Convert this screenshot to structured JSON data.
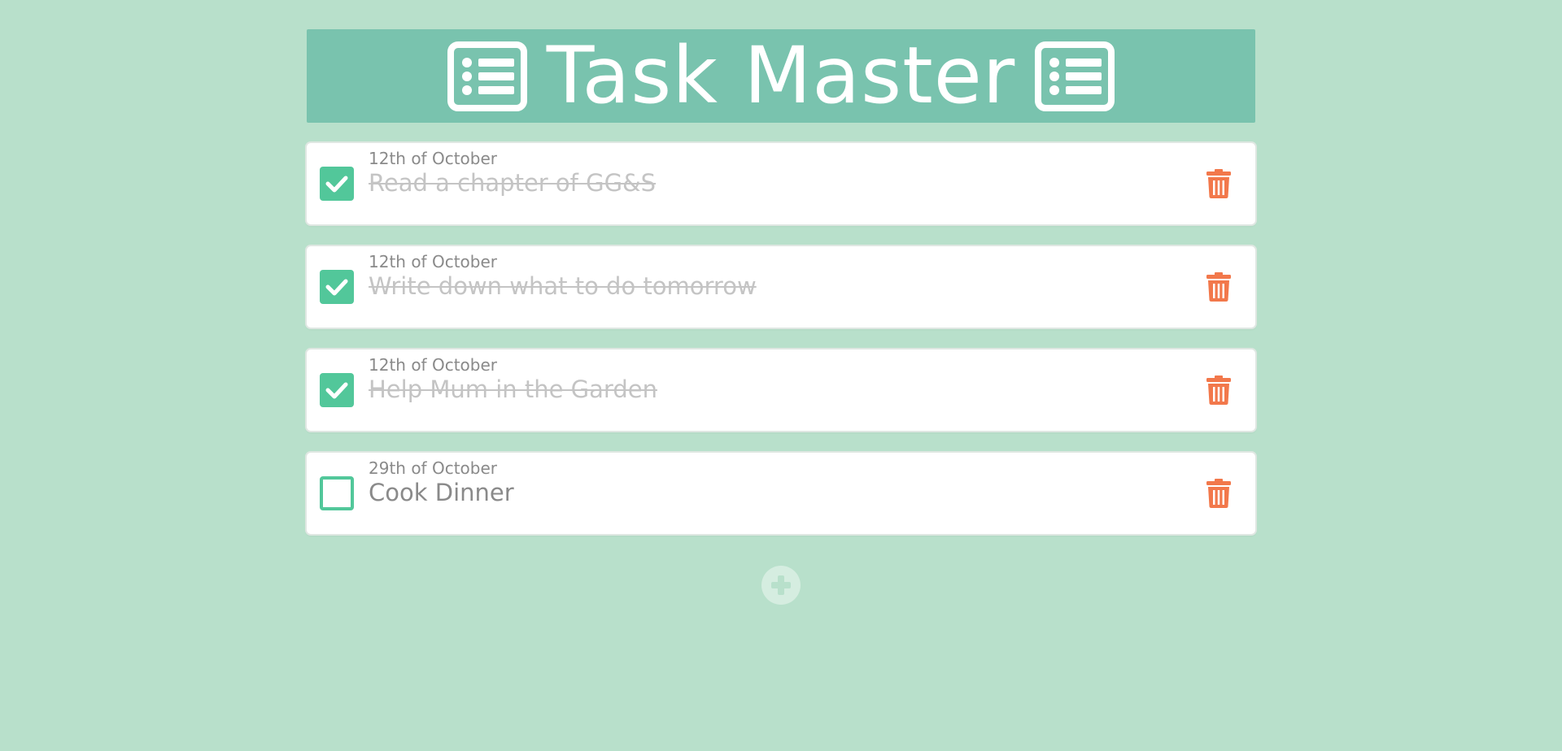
{
  "header": {
    "title": "Task Master",
    "left_icon": "list-alt-icon",
    "right_icon": "list-alt-icon"
  },
  "tasks": [
    {
      "date": "12th of October",
      "text": "Read a chapter of GG&S",
      "done": true
    },
    {
      "date": "12th of October",
      "text": "Write down what to do tomorrow",
      "done": true
    },
    {
      "date": "12th of October",
      "text": "Help Mum in the Garden",
      "done": true
    },
    {
      "date": "29th of October",
      "text": "Cook Dinner",
      "done": false
    }
  ],
  "icons": {
    "checkbox_checked": "check-icon",
    "delete": "trash-icon",
    "add": "plus-circle-icon"
  },
  "colors": {
    "background": "#b8e0cb",
    "header": "#79c3ae",
    "accent": "#52c79a",
    "delete": "#f2784b",
    "add_button": "#d5ede0"
  }
}
